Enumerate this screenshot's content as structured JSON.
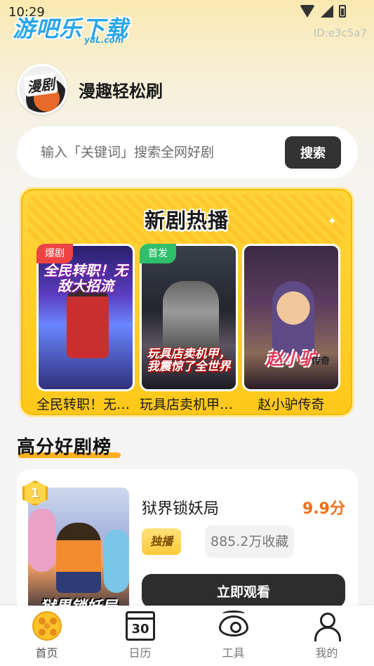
{
  "status_bar": {
    "time": "10:29"
  },
  "watermark": {
    "title": "游吧乐下载",
    "subtitle": "y8L.com"
  },
  "device_id": "ID:e3c5a7",
  "app": {
    "name": "漫趣轻松刷",
    "logo_text": "漫剧"
  },
  "search": {
    "placeholder": "输入「关键词」搜索全网好剧",
    "button_label": "搜索"
  },
  "hot_section": {
    "title": "新剧热播",
    "items": [
      {
        "tag": "爆剧",
        "cover_text": "全民转职！无敌大招流",
        "name": "全民转职！无敌大招流",
        "tag_color": "#ef4343"
      },
      {
        "tag": "首发",
        "cover_text": "玩具店卖机甲，我震惊了全世界",
        "name": "玩具店卖机甲，我震惊了全世界",
        "tag_color": "#2fbf6b"
      },
      {
        "tag": "",
        "cover_text": "赵小驴",
        "cover_sub": "传奇",
        "name": "赵小驴传奇"
      }
    ]
  },
  "ranking": {
    "title": "高分好剧榜",
    "items": [
      {
        "rank": "1",
        "name": "狱界锁妖局",
        "cover_text": "狱界锁妖局",
        "score": "9.9分",
        "exclusive_tag": "独播",
        "favorites": "885.2万收藏",
        "watch_label": "立即观看"
      }
    ]
  },
  "bottom_nav": [
    {
      "label": "首页",
      "icon": "film-reel-icon",
      "active": true
    },
    {
      "label": "日历",
      "icon": "calendar-icon",
      "calendar_number": "30"
    },
    {
      "label": "工具",
      "icon": "eye-icon"
    },
    {
      "label": "我的",
      "icon": "user-icon"
    }
  ],
  "colors": {
    "accent": "#ffc81a",
    "score": "#f07018",
    "button_dark": "#333333"
  }
}
